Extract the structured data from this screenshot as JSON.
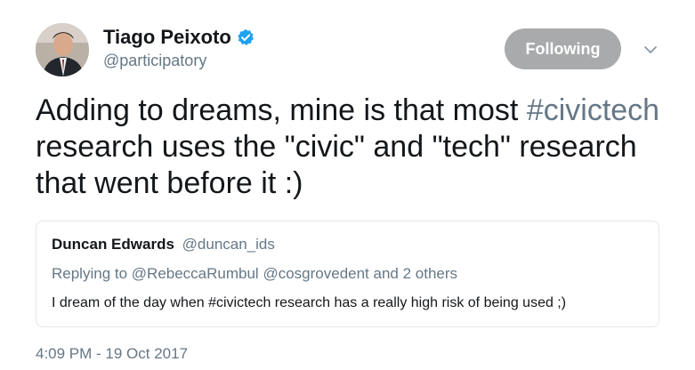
{
  "author": {
    "name": "Tiago Peixoto",
    "handle": "@participatory",
    "avatar_icon": "profile-photo",
    "verified_icon": "verified-badge-icon",
    "verified_color": "#1da1f2"
  },
  "follow_button": {
    "label": "Following",
    "background": "#a8aaab"
  },
  "menu_icon": "chevron-down-icon",
  "tweet": {
    "text_before": "Adding to dreams, mine is that most ",
    "hashtag": "#civictech",
    "text_after": " research uses the \"civic\" and \"tech\" research that went before it :)"
  },
  "quoted_tweet": {
    "name": "Duncan Edwards",
    "handle": "@duncan_ids",
    "reply_prefix": "Replying to ",
    "reply_mention_1": "@RebeccaRumbul",
    "reply_mention_2": "@cosgrovedent",
    "reply_suffix": " and 2 others",
    "text": "I dream of the day when #civictech research has a really high risk of being used ;)"
  },
  "timestamp": "4:09 PM - 19 Oct 2017"
}
